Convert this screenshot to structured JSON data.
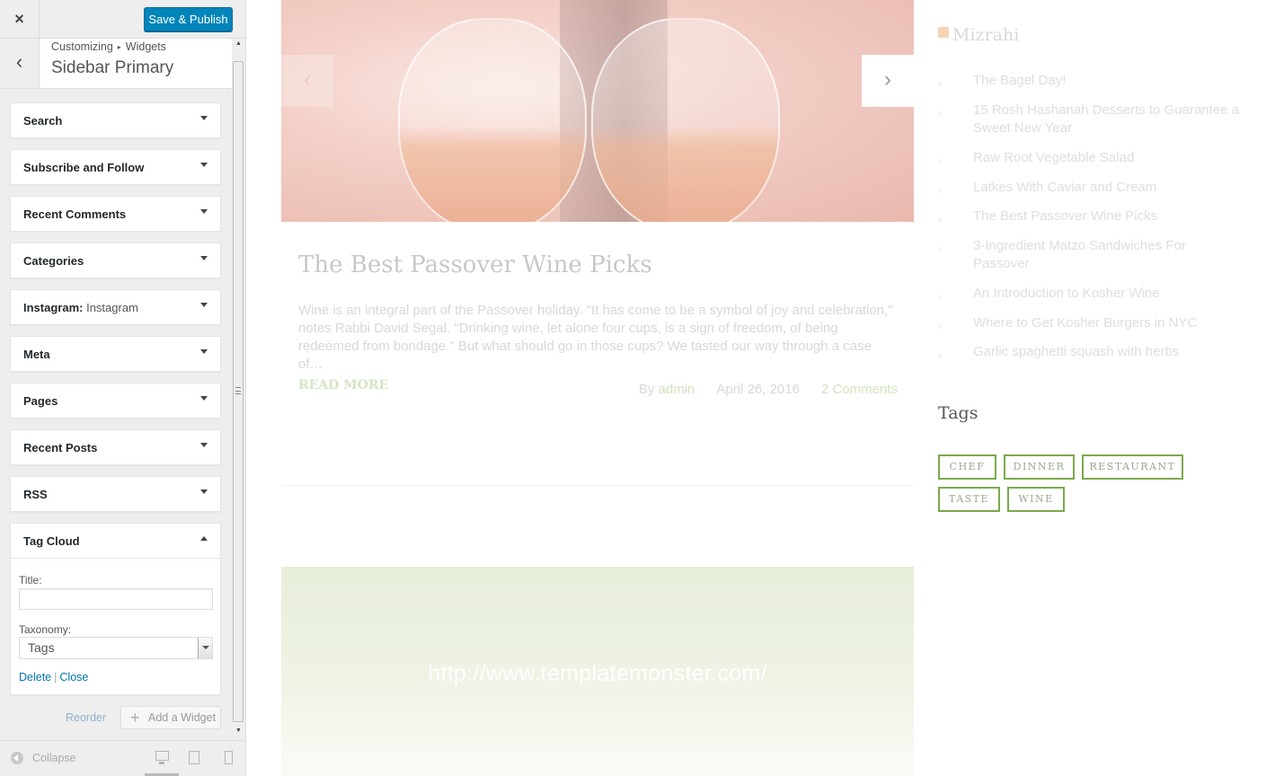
{
  "customizer": {
    "close_icon": "×",
    "publish_label": "Save & Publish",
    "back_icon": "‹",
    "breadcrumb": {
      "root": "Customizing",
      "separator": "▸",
      "current": "Widgets"
    },
    "section_title": "Sidebar Primary",
    "widgets": [
      {
        "title": "Search"
      },
      {
        "title": "Subscribe and Follow"
      },
      {
        "title": "Recent Comments"
      },
      {
        "title": "Categories"
      },
      {
        "title": "Instagram:",
        "subtitle": "Instagram"
      },
      {
        "title": "Meta"
      },
      {
        "title": "Pages"
      },
      {
        "title": "Recent Posts"
      },
      {
        "title": "RSS"
      }
    ],
    "tag_cloud": {
      "title": "Tag Cloud",
      "title_label": "Title:",
      "title_value": "",
      "taxonomy_label": "Taxonomy:",
      "taxonomy_value": "Tags",
      "delete_label": "Delete",
      "separator": "|",
      "close_label": "Close"
    },
    "reorder_label": "Reorder",
    "add_widget_label": "Add a Widget",
    "collapse_label": "Collapse"
  },
  "preview": {
    "slider": {
      "prev_icon": "‹",
      "next_icon": "›"
    },
    "post": {
      "title": "The Best Passover Wine Picks",
      "excerpt": "Wine is an integral part of the Passover holiday. \"It has come to be a symbol of joy and celebration,\" notes Rabbi David Segal. \"Drinking wine, let alone four cups, is a sign of freedom, of being redeemed from bondage.\" But what should go in those cups? We tasted our way through a case of…",
      "read_more": "READ MORE",
      "by": "By",
      "author": "admin",
      "date": "April 26, 2016",
      "comments": "2 Comments"
    },
    "link_post": {
      "url": "http://www.templatemonster.com/"
    },
    "sidebar": {
      "rss_title": "Mizrahi",
      "rss_items": [
        "The Bagel Day!",
        "15 Rosh Hashanah Desserts to Guarantee a Sweet New Year",
        "Raw Root Vegetable Salad",
        "Latkes With Caviar and Cream",
        "The Best Passover Wine Picks",
        "3-Ingredient Matzo Sandwiches For Passover",
        "An Introduction to Kosher Wine",
        "Where to Get Kosher Burgers in NYC",
        "Garlic spaghetti squash with herbs"
      ],
      "tags_title": "Tags",
      "tags": [
        "CHEF",
        "DINNER",
        "RESTAURANT",
        "TASTE",
        "WINE"
      ]
    }
  },
  "colors": {
    "accent": "#0085ba",
    "tag_border": "#7ba94c"
  }
}
